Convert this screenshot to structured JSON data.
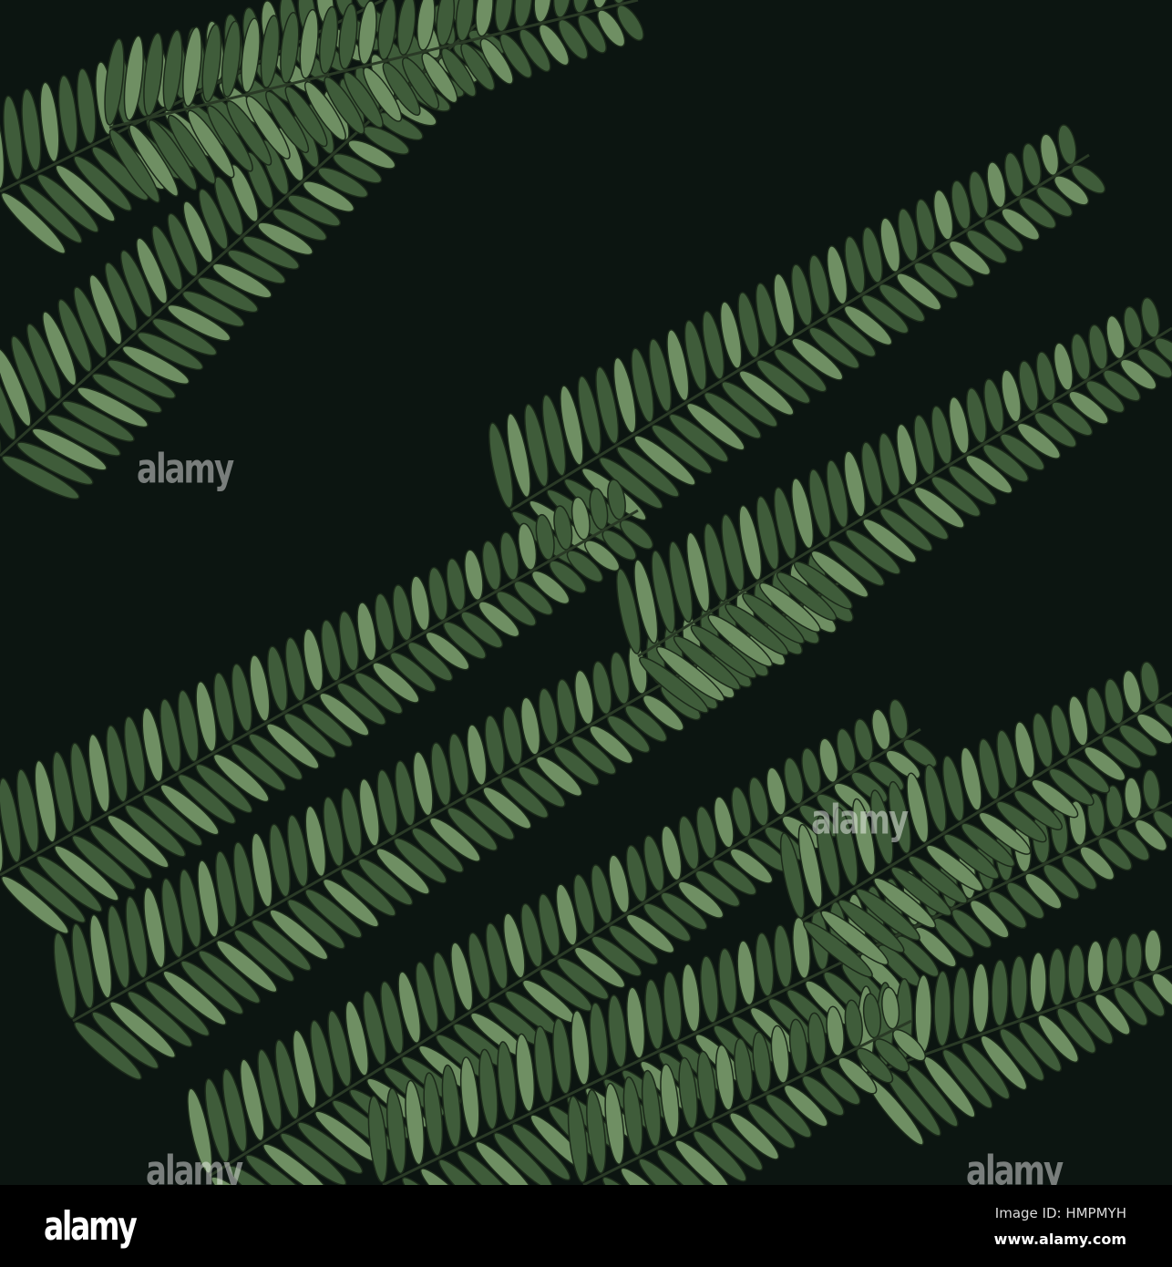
{
  "photo": {
    "subject": "fern-fronds",
    "colors": {
      "background": "#0c1511",
      "leaf": "#3f5c3a",
      "leaf_light": "#6f8f63",
      "rachis": "#2a3a26"
    }
  },
  "watermark": {
    "text": "alamy"
  },
  "footer": {
    "logo": "alamy",
    "image_id": "Image ID: HMPMYH",
    "website": "www.alamy.com"
  }
}
